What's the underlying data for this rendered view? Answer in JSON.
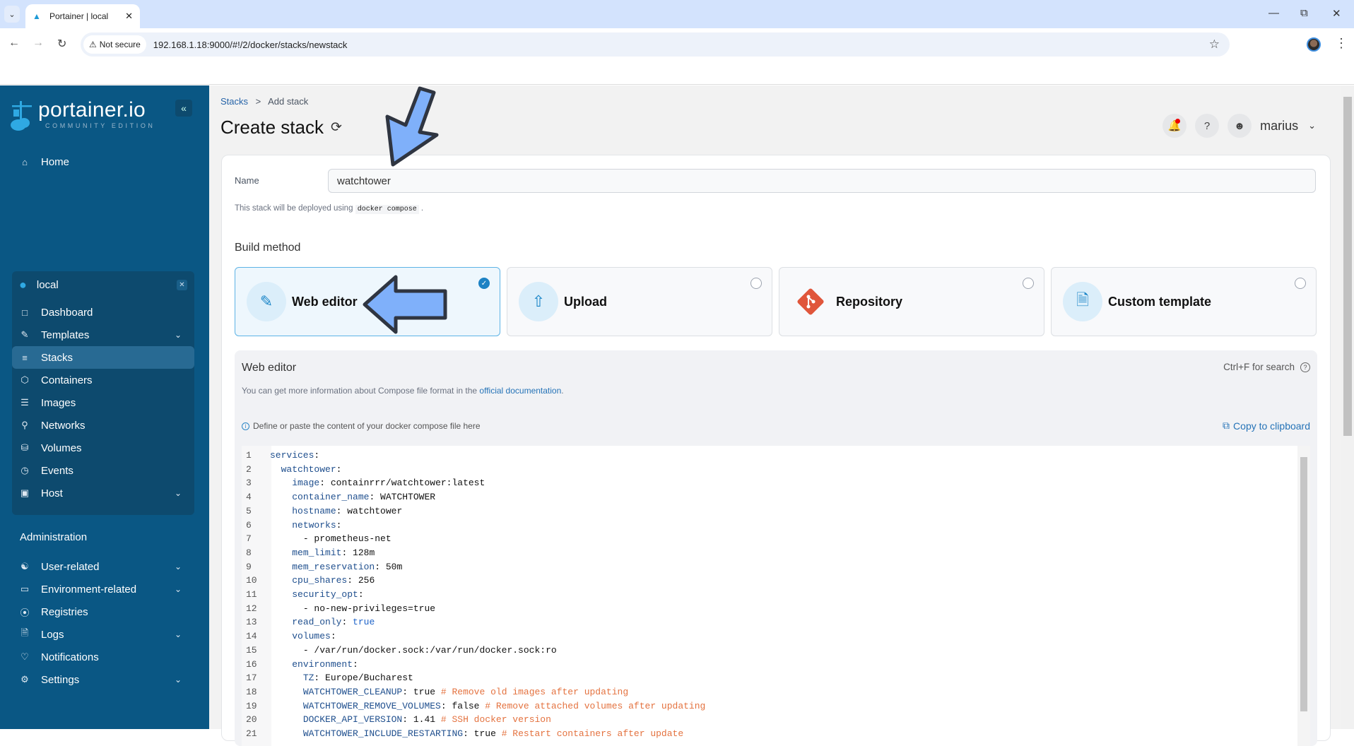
{
  "browser": {
    "tab_title": "Portainer | local",
    "security_label": "Not secure",
    "url": "192.168.1.18:9000/#!/2/docker/stacks/newstack"
  },
  "sidebar": {
    "brand": "portainer.io",
    "edition": "COMMUNITY EDITION",
    "home": "Home",
    "environment": {
      "name": "local",
      "items": [
        {
          "label": "Dashboard",
          "icon": "dashboard-icon",
          "chevron": false
        },
        {
          "label": "Templates",
          "icon": "edit-icon",
          "chevron": true
        },
        {
          "label": "Stacks",
          "icon": "layers-icon",
          "chevron": false,
          "active": true
        },
        {
          "label": "Containers",
          "icon": "box-icon",
          "chevron": false
        },
        {
          "label": "Images",
          "icon": "list-icon",
          "chevron": false
        },
        {
          "label": "Networks",
          "icon": "network-icon",
          "chevron": false
        },
        {
          "label": "Volumes",
          "icon": "database-icon",
          "chevron": false
        },
        {
          "label": "Events",
          "icon": "clock-icon",
          "chevron": false
        },
        {
          "label": "Host",
          "icon": "host-icon",
          "chevron": true
        }
      ]
    },
    "admin_title": "Administration",
    "admin_items": [
      {
        "label": "User-related",
        "icon": "users-icon",
        "chevron": true
      },
      {
        "label": "Environment-related",
        "icon": "drive-icon",
        "chevron": true
      },
      {
        "label": "Registries",
        "icon": "radio-icon",
        "chevron": false
      },
      {
        "label": "Logs",
        "icon": "file-icon",
        "chevron": true
      },
      {
        "label": "Notifications",
        "icon": "bell-icon",
        "chevron": false
      },
      {
        "label": "Settings",
        "icon": "gear-icon",
        "chevron": true
      }
    ]
  },
  "header": {
    "breadcrumb_root": "Stacks",
    "breadcrumb_sep": ">",
    "breadcrumb_current": "Add stack",
    "title": "Create stack",
    "user": "marius"
  },
  "form": {
    "name_label": "Name",
    "name_value": "watchtower",
    "deploy_note_prefix": "This stack will be deployed using",
    "deploy_note_code": "docker compose",
    "deploy_note_suffix": ".",
    "build_method_title": "Build method",
    "build_methods": [
      {
        "label": "Web editor",
        "icon": "edit-icon",
        "selected": true
      },
      {
        "label": "Upload",
        "icon": "upload-cloud-icon",
        "selected": false
      },
      {
        "label": "Repository",
        "icon": "git-icon",
        "selected": false
      },
      {
        "label": "Custom template",
        "icon": "file-text-icon",
        "selected": false
      }
    ]
  },
  "editor": {
    "title": "Web editor",
    "search_hint": "Ctrl+F for search",
    "info_prefix": "You can get more information about Compose file format in the",
    "info_link": "official documentation",
    "info_suffix": ".",
    "hint": "Define or paste the content of your docker compose file here",
    "copy_label": "Copy to clipboard",
    "lines": [
      {
        "n": "1",
        "indent": "",
        "key": "services",
        "sep": ":",
        "val": "",
        "bool": "",
        "comment": ""
      },
      {
        "n": "2",
        "indent": "  ",
        "key": "watchtower",
        "sep": ":",
        "val": "",
        "bool": "",
        "comment": ""
      },
      {
        "n": "3",
        "indent": "    ",
        "key": "image",
        "sep": ": ",
        "val": "containrrr/watchtower:latest",
        "bool": "",
        "comment": ""
      },
      {
        "n": "4",
        "indent": "    ",
        "key": "container_name",
        "sep": ": ",
        "val": "WATCHTOWER",
        "bool": "",
        "comment": ""
      },
      {
        "n": "5",
        "indent": "    ",
        "key": "hostname",
        "sep": ": ",
        "val": "watchtower",
        "bool": "",
        "comment": ""
      },
      {
        "n": "6",
        "indent": "    ",
        "key": "networks",
        "sep": ":",
        "val": "",
        "bool": "",
        "comment": ""
      },
      {
        "n": "7",
        "indent": "      ",
        "key": "",
        "sep": "",
        "val": "- prometheus-net",
        "bool": "",
        "comment": ""
      },
      {
        "n": "8",
        "indent": "    ",
        "key": "mem_limit",
        "sep": ": ",
        "val": "128m",
        "bool": "",
        "comment": ""
      },
      {
        "n": "9",
        "indent": "    ",
        "key": "mem_reservation",
        "sep": ": ",
        "val": "50m",
        "bool": "",
        "comment": ""
      },
      {
        "n": "10",
        "indent": "    ",
        "key": "cpu_shares",
        "sep": ": ",
        "val": "256",
        "bool": "",
        "comment": ""
      },
      {
        "n": "11",
        "indent": "    ",
        "key": "security_opt",
        "sep": ":",
        "val": "",
        "bool": "",
        "comment": ""
      },
      {
        "n": "12",
        "indent": "      ",
        "key": "",
        "sep": "",
        "val": "- no-new-privileges=true",
        "bool": "",
        "comment": ""
      },
      {
        "n": "13",
        "indent": "    ",
        "key": "read_only",
        "sep": ": ",
        "val": "",
        "bool": "true",
        "comment": ""
      },
      {
        "n": "14",
        "indent": "    ",
        "key": "volumes",
        "sep": ":",
        "val": "",
        "bool": "",
        "comment": ""
      },
      {
        "n": "15",
        "indent": "      ",
        "key": "",
        "sep": "",
        "val": "- /var/run/docker.sock:/var/run/docker.sock:ro",
        "bool": "",
        "comment": ""
      },
      {
        "n": "16",
        "indent": "    ",
        "key": "environment",
        "sep": ":",
        "val": "",
        "bool": "",
        "comment": ""
      },
      {
        "n": "17",
        "indent": "      ",
        "key": "TZ",
        "sep": ": ",
        "val": "Europe/Bucharest",
        "bool": "",
        "comment": ""
      },
      {
        "n": "18",
        "indent": "      ",
        "key": "WATCHTOWER_CLEANUP",
        "sep": ": ",
        "val": "true ",
        "bool": "",
        "comment": "# Remove old images after updating"
      },
      {
        "n": "19",
        "indent": "      ",
        "key": "WATCHTOWER_REMOVE_VOLUMES",
        "sep": ": ",
        "val": "false ",
        "bool": "",
        "comment": "# Remove attached volumes after updating"
      },
      {
        "n": "20",
        "indent": "      ",
        "key": "DOCKER_API_VERSION",
        "sep": ": ",
        "val": "1.41 ",
        "bool": "",
        "comment": "# SSH docker version"
      },
      {
        "n": "21",
        "indent": "      ",
        "key": "WATCHTOWER_INCLUDE_RESTARTING",
        "sep": ": ",
        "val": "true ",
        "bool": "",
        "comment": "# Restart containers after update"
      }
    ]
  }
}
